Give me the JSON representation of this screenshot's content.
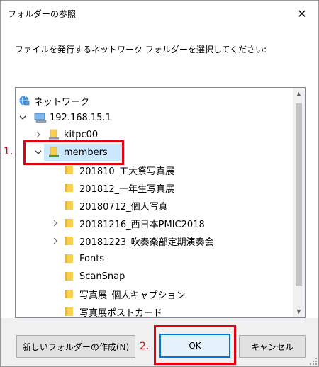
{
  "window": {
    "title": "フォルダーの参照",
    "close_glyph": "✕"
  },
  "instruction": "ファイルを発行するネットワーク フォルダーを選択してください:",
  "tree": {
    "items": [
      {
        "label": "ネットワーク",
        "icon": "network-icon",
        "expander": "none"
      },
      {
        "label": "192.168.15.1",
        "icon": "computer-icon",
        "expander": "expanded"
      },
      {
        "label": "kitpc00",
        "icon": "shared-folder-icon",
        "expander": "collapsed"
      },
      {
        "label": "members",
        "icon": "shared-folder-icon",
        "expander": "expanded",
        "selected": true
      },
      {
        "label": "201810_工大祭写真展",
        "icon": "folder-icon",
        "expander": "none"
      },
      {
        "label": "201812_一年生写真展",
        "icon": "folder-icon",
        "expander": "none"
      },
      {
        "label": "20180712_個人写真",
        "icon": "folder-icon",
        "expander": "none"
      },
      {
        "label": "20181216_西日本PMIC2018",
        "icon": "folder-icon",
        "expander": "collapsed"
      },
      {
        "label": "20181223_吹奏楽部定期演奏会",
        "icon": "folder-icon",
        "expander": "collapsed"
      },
      {
        "label": "Fonts",
        "icon": "folder-icon",
        "expander": "none"
      },
      {
        "label": "ScanSnap",
        "icon": "folder-icon",
        "expander": "none"
      },
      {
        "label": "写真展_個人キャプション",
        "icon": "folder-icon",
        "expander": "none"
      },
      {
        "label": "写真展ポストカード",
        "icon": "folder-icon",
        "expander": "none"
      }
    ]
  },
  "annotations": {
    "step1": "1.",
    "step2": "2."
  },
  "buttons": {
    "new_folder": "新しいフォルダーの作成(N)",
    "ok": "OK",
    "cancel": "キャンセル"
  },
  "colors": {
    "accent": "#0078d7",
    "selection": "#cce8ff",
    "annotation": "#e3000f",
    "folder": "#f7cf52"
  }
}
